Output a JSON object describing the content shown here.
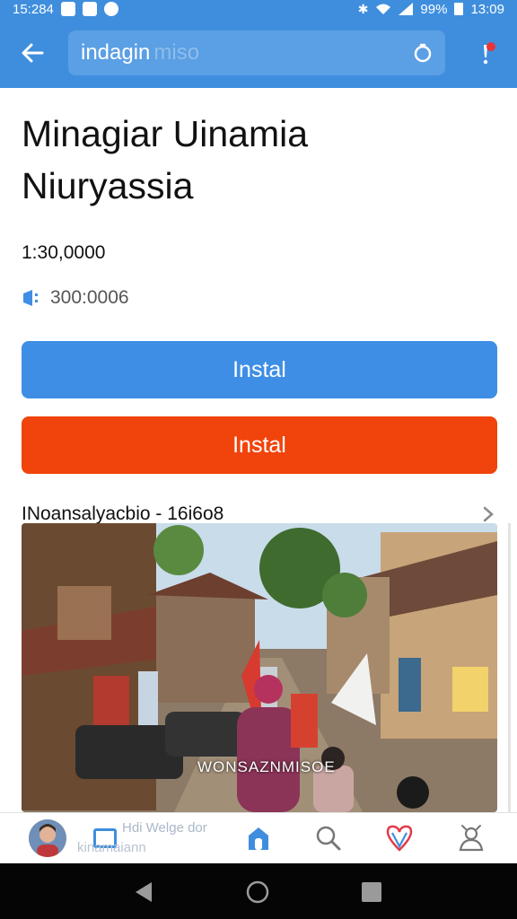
{
  "status_bar": {
    "time_left": "15:284",
    "battery_percent": "99%",
    "clock": "13:09"
  },
  "search": {
    "value": "indagin",
    "ghost_text": "miso"
  },
  "app": {
    "title_line1": "Minagiar Uinamia",
    "title_line2": "Niuryassia",
    "meta_value": "1:30,0000",
    "meta_secondary": "300:0006"
  },
  "buttons": {
    "primary_label": "Instal",
    "secondary_label": "Instal"
  },
  "section": {
    "label": "INoansalyacbio - 16i6o8"
  },
  "photo": {
    "caption": "WONSAZNMISOE"
  },
  "bottom_nav": {
    "chip_text_1": "Hdi Welge dor",
    "chip_text_2": "kinamaiann"
  },
  "colors": {
    "accent_blue": "#3f8ede",
    "button_blue": "#3e8ee5",
    "button_orange": "#f0440c"
  },
  "icons": [
    "back-arrow",
    "clear",
    "notification-alert",
    "tag",
    "chevron-right",
    "home",
    "search",
    "heart",
    "profile",
    "android-back",
    "android-home",
    "android-recents"
  ]
}
